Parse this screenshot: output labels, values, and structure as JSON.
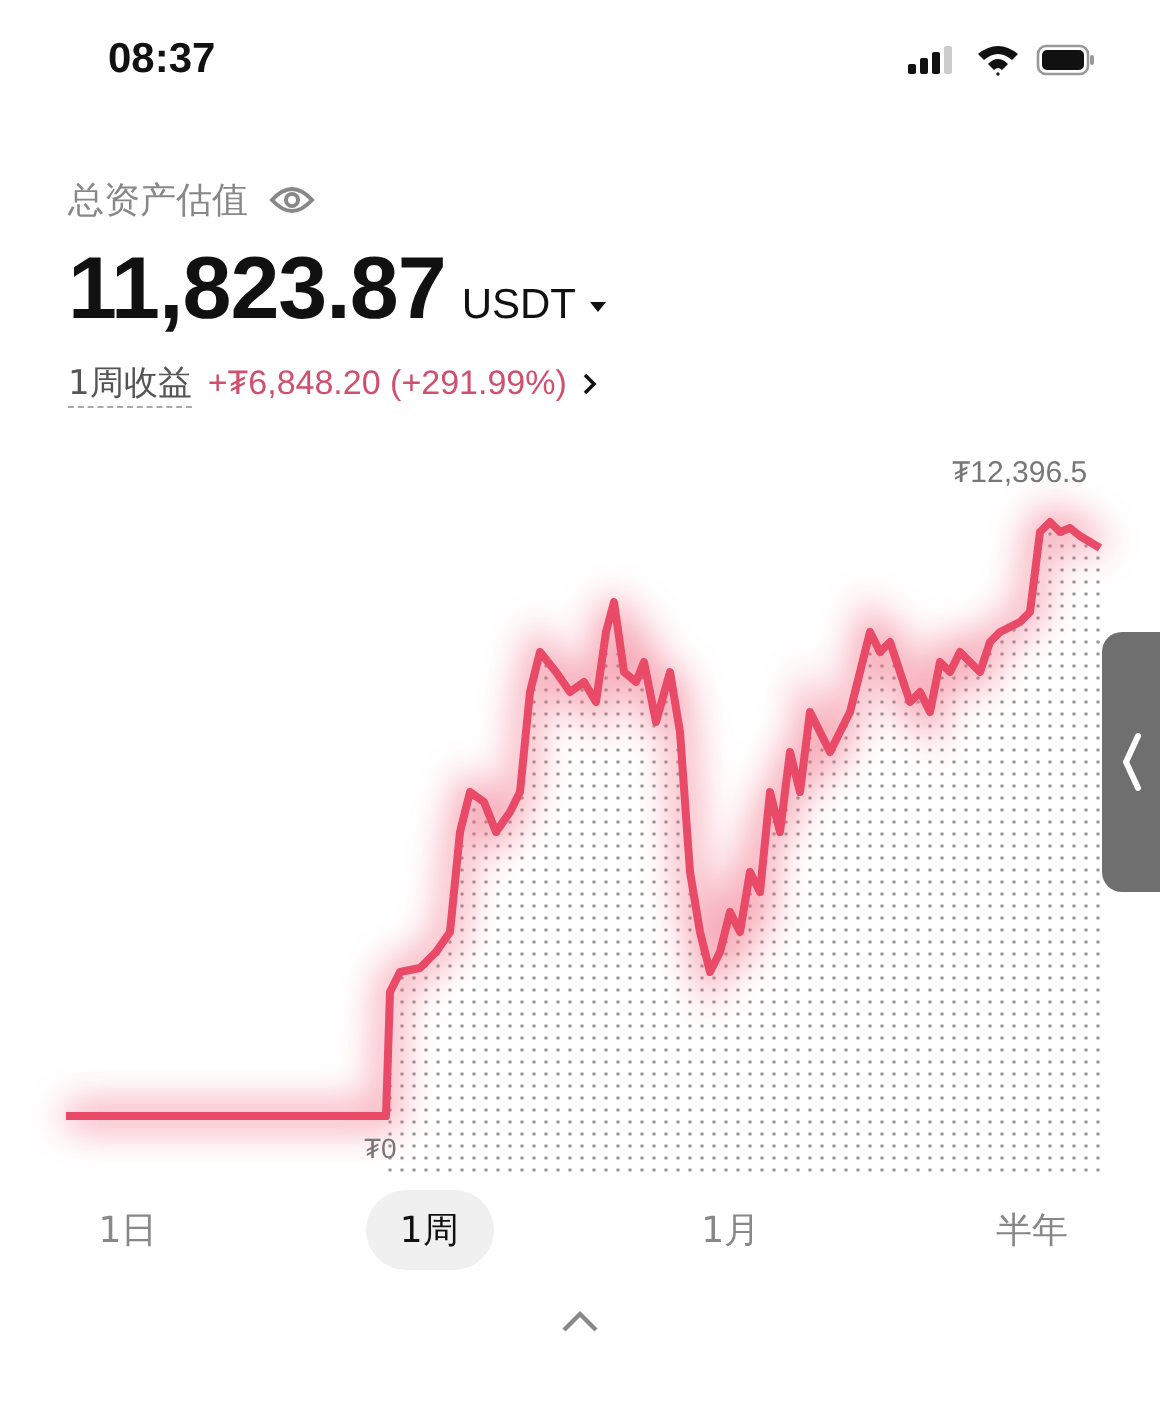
{
  "status_bar": {
    "time": "08:37"
  },
  "balance": {
    "label": "总资产估值",
    "amount": "11,823.87",
    "currency": "USDT",
    "pnl_label": "1周收益",
    "pnl_value": "+₮6,848.20 (+291.99%)"
  },
  "chart": {
    "kind": "picture",
    "max_label": "₮12,396.5",
    "min_label": "₮0"
  },
  "tabs": [
    {
      "label": "1日",
      "selected": false
    },
    {
      "label": "1周",
      "selected": true
    },
    {
      "label": "1月",
      "selected": false
    },
    {
      "label": "半年",
      "selected": false
    }
  ]
}
